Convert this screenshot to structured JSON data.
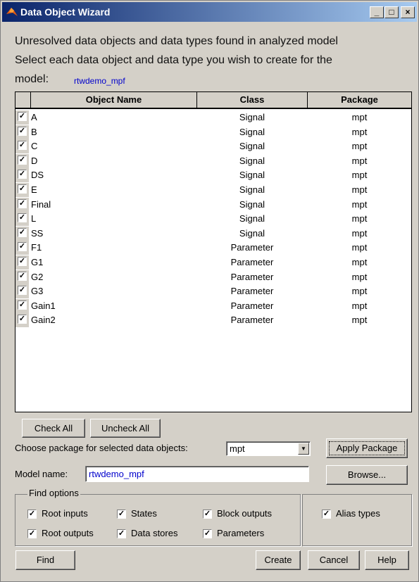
{
  "window": {
    "title": "Data Object Wizard",
    "minimize": "_",
    "maximize": "□",
    "close": "×"
  },
  "intro": {
    "line1": "Unresolved data objects and data types found in analyzed model",
    "line2": "Select each data object and data type you wish to create for the",
    "line3": "model:",
    "model_link": "rtwdemo_mpf"
  },
  "table": {
    "columns": [
      "Object Name",
      "Class",
      "Package"
    ],
    "rows": [
      {
        "checked": true,
        "name": "A",
        "class": "Signal",
        "package": "mpt"
      },
      {
        "checked": true,
        "name": "B",
        "class": "Signal",
        "package": "mpt"
      },
      {
        "checked": true,
        "name": "C",
        "class": "Signal",
        "package": "mpt"
      },
      {
        "checked": true,
        "name": "D",
        "class": "Signal",
        "package": "mpt"
      },
      {
        "checked": true,
        "name": "DS",
        "class": "Signal",
        "package": "mpt"
      },
      {
        "checked": true,
        "name": "E",
        "class": "Signal",
        "package": "mpt"
      },
      {
        "checked": true,
        "name": "Final",
        "class": "Signal",
        "package": "mpt"
      },
      {
        "checked": true,
        "name": "L",
        "class": "Signal",
        "package": "mpt"
      },
      {
        "checked": true,
        "name": "SS",
        "class": "Signal",
        "package": "mpt"
      },
      {
        "checked": true,
        "name": "F1",
        "class": "Parameter",
        "package": "mpt"
      },
      {
        "checked": true,
        "name": "G1",
        "class": "Parameter",
        "package": "mpt"
      },
      {
        "checked": true,
        "name": "G2",
        "class": "Parameter",
        "package": "mpt"
      },
      {
        "checked": true,
        "name": "G3",
        "class": "Parameter",
        "package": "mpt"
      },
      {
        "checked": true,
        "name": "Gain1",
        "class": "Parameter",
        "package": "mpt"
      },
      {
        "checked": true,
        "name": "Gain2",
        "class": "Parameter",
        "package": "mpt"
      }
    ]
  },
  "buttons": {
    "check_all": "Check All",
    "uncheck_all": "Uncheck All",
    "apply_package": "Apply Package",
    "browse": "Browse...",
    "find": "Find",
    "create": "Create",
    "cancel": "Cancel",
    "help": "Help"
  },
  "package_select": {
    "label": "Choose package for selected data objects:",
    "value": "mpt"
  },
  "model_name": {
    "label": "Model name:",
    "value": "rtwdemo_mpf"
  },
  "find_options": {
    "legend": "Find options",
    "root_inputs": "Root inputs",
    "states": "States",
    "block_outputs": "Block outputs",
    "root_outputs": "Root outputs",
    "data_stores": "Data stores",
    "parameters": "Parameters",
    "alias_types": "Alias types"
  },
  "check_mark": "✓",
  "colors": {
    "title_start": "#0a246a",
    "title_end": "#a6caf0",
    "face": "#d4d0c8",
    "link": "#0000cc"
  }
}
